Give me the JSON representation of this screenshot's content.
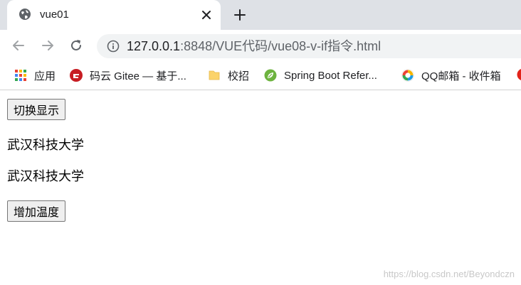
{
  "browser": {
    "tab": {
      "title": "vue01",
      "favicon": "globe-icon"
    },
    "toolbar": {
      "back_icon": "back-arrow-icon",
      "forward_icon": "forward-arrow-icon",
      "reload_icon": "reload-icon",
      "url_host": "127.0.0.1",
      "url_rest": ":8848/VUE代码/vue08-v-if指令.html"
    },
    "bookmarks": [
      {
        "label": "应用",
        "icon": "apps-grid-icon"
      },
      {
        "label": "码云 Gitee — 基于...",
        "icon": "gitee-icon"
      },
      {
        "label": "校招",
        "icon": "folder-icon"
      },
      {
        "label": "Spring Boot Refer...",
        "icon": "spring-leaf-icon"
      },
      {
        "label": "QQ邮箱 - 收件箱",
        "icon": "qq-mail-icon"
      }
    ]
  },
  "page": {
    "toggle_button_label": "切换显示",
    "paragraph_1": "武汉科技大学",
    "paragraph_2": "武汉科技大学",
    "increase_button_label": "增加温度",
    "watermark": "https://blog.csdn.net/Beyondczn"
  },
  "colors": {
    "tabstrip_bg": "#dee1e6",
    "omnibox_bg": "#f1f3f4",
    "gitee_red": "#c71d23",
    "spring_green": "#6db33f"
  }
}
